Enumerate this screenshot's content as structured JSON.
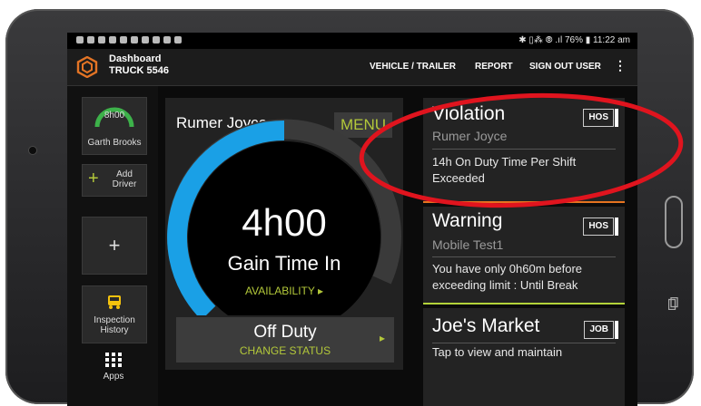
{
  "statusbar": {
    "right_text": "✱ ▯⁂ ⦾ .ıl 76% ▮ 11:22 am"
  },
  "appbar": {
    "title": "Dashboard",
    "subtitle": "TRUCK 5546",
    "nav": [
      "VEHICLE / TRAILER",
      "REPORT",
      "SIGN OUT USER"
    ],
    "more": "⋮"
  },
  "left": {
    "driver_time": "8h00",
    "driver_name": "Garth Brooks",
    "add_driver": "Add Driver",
    "plus": "+",
    "inspection_label": "Inspection History",
    "apps_label": "Apps"
  },
  "main": {
    "driver_name": "Rumer Joyce",
    "menu_label": "MENU",
    "gauge_time": "4h00",
    "gauge_subtitle": "Gain Time In",
    "availability": "AVAILABILITY ▸",
    "gauge_level": 0.5,
    "status": "Off Duty",
    "change_status": "CHANGE STATUS",
    "arrow": "▸"
  },
  "cards": [
    {
      "title": "Violation",
      "tag": "HOS",
      "sub": "Rumer Joyce",
      "body": "14h On Duty Time Per Shift Exceeded",
      "accent": "#e6731f"
    },
    {
      "title": "Warning",
      "tag": "HOS",
      "sub": "Mobile Test1",
      "body": "You have only 0h60m before exceeding limit : Until Break",
      "accent": "#b3d33a"
    },
    {
      "title": "Joe's Market",
      "tag": "JOB",
      "sub": "",
      "body": "Tap to view and maintain"
    }
  ],
  "colors": {
    "gauge_blue": "#1aa0e6",
    "gauge_track": "#3a3a3a",
    "accent_green": "#b3c83a",
    "annotation_red": "#e0141e",
    "logo_orange": "#e37425"
  }
}
